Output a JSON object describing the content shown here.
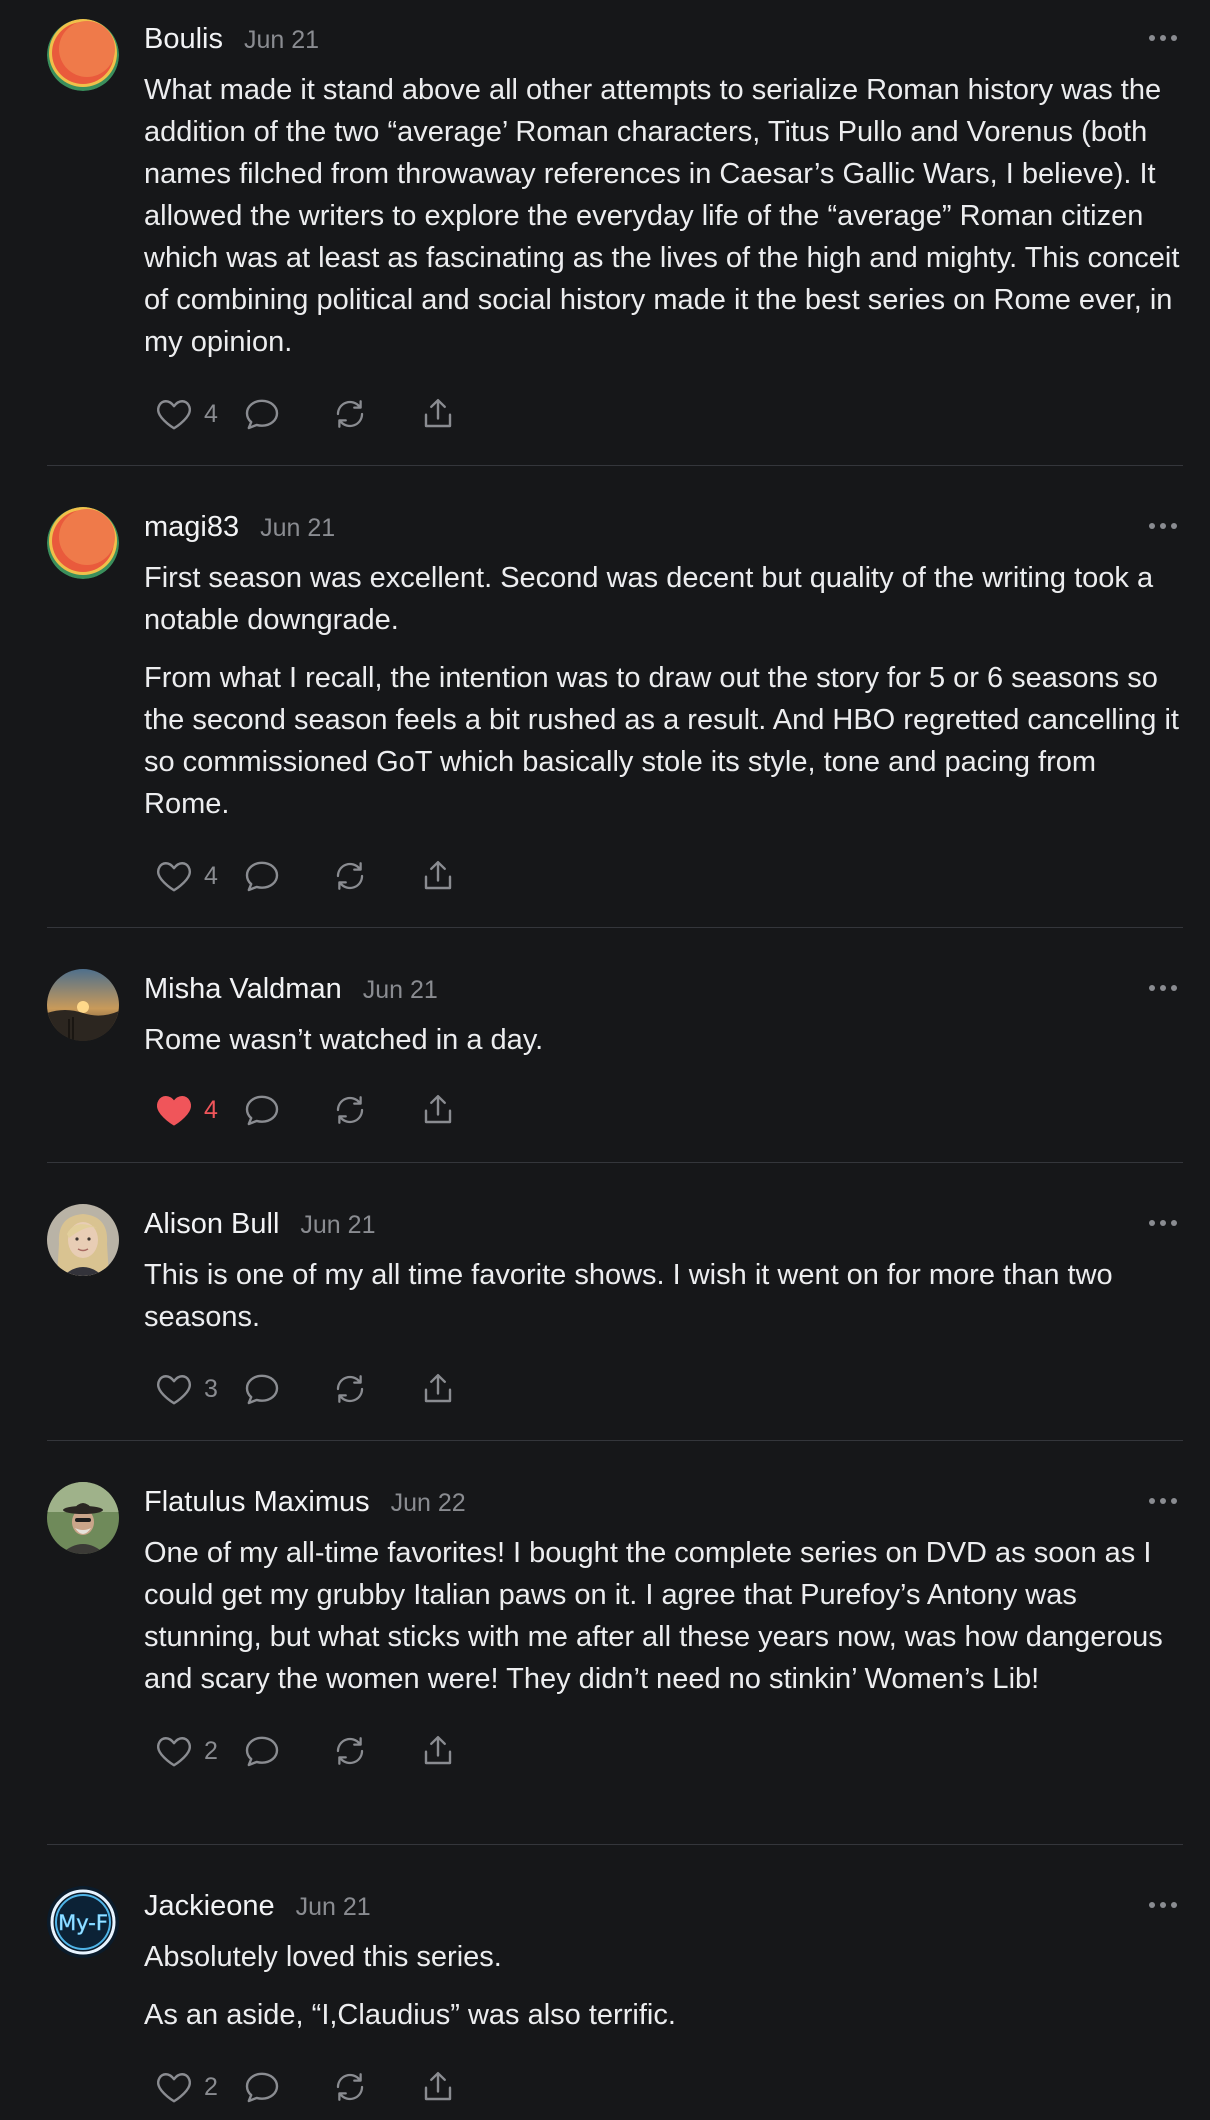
{
  "comments": [
    {
      "author": "Boulis",
      "date": "Jun 21",
      "paragraphs": [
        "What made it stand above all other attempts to serialize Roman history was the addition of the two “average’ Roman characters, Titus Pullo and Vorenus (both names filched from throwaway references in Caesar’s Gallic Wars, I believe). It allowed the writers to explore the everyday life of the “average” Roman citizen which was at least as fascinating as the lives of the high and mighty. This conceit of combining political and social history made it the best series on Rome ever, in my opinion."
      ],
      "likes": "4",
      "liked": false,
      "avatar": "orange-circle-avatar"
    },
    {
      "author": "magi83",
      "date": "Jun 21",
      "paragraphs": [
        "First season was excellent. Second was decent but quality of the writing took a notable downgrade.",
        "From what I recall, the intention was to draw out the story for 5 or 6 seasons so the second season feels a bit rushed as a result. And HBO regretted cancelling it so commissioned GoT which basically stole its style, tone and pacing from Rome."
      ],
      "likes": "4",
      "liked": false,
      "avatar": "orange-circle-avatar"
    },
    {
      "author": "Misha Valdman",
      "date": "Jun 21",
      "paragraphs": [
        "Rome wasn’t watched in a day."
      ],
      "likes": "4",
      "liked": true,
      "avatar": "sunset-photo-avatar"
    },
    {
      "author": "Alison Bull",
      "date": "Jun 21",
      "paragraphs": [
        "This is one of my all time favorite shows. I wish it went on for more than two seasons."
      ],
      "likes": "3",
      "liked": false,
      "avatar": "blonde-woman-photo-avatar"
    },
    {
      "author": "Flatulus Maximus",
      "date": "Jun 22",
      "paragraphs": [
        "One of my all-time favorites! I bought the complete series on DVD as soon as I could get my grubby Italian paws on it. I agree that Purefoy’s Antony was stunning, but what sticks with me after all these years now, was how dangerous and scary the women were! They didn’t need no stinkin’ Women’s Lib!"
      ],
      "likes": "2",
      "liked": false,
      "avatar": "man-with-hat-photo-avatar"
    },
    {
      "author": "Jackieone",
      "date": "Jun 21",
      "paragraphs": [
        "Absolutely loved this series.",
        "As an aside, “I,Claudius” was also terrific."
      ],
      "likes": "2",
      "liked": false,
      "avatar": "neon-sign-avatar",
      "avatar_text": "My-F"
    }
  ],
  "colors": {
    "background": "#161719",
    "text": "#ecedef",
    "muted": "#8a8c91",
    "like_active": "#f0555a",
    "divider": "#34363b"
  }
}
